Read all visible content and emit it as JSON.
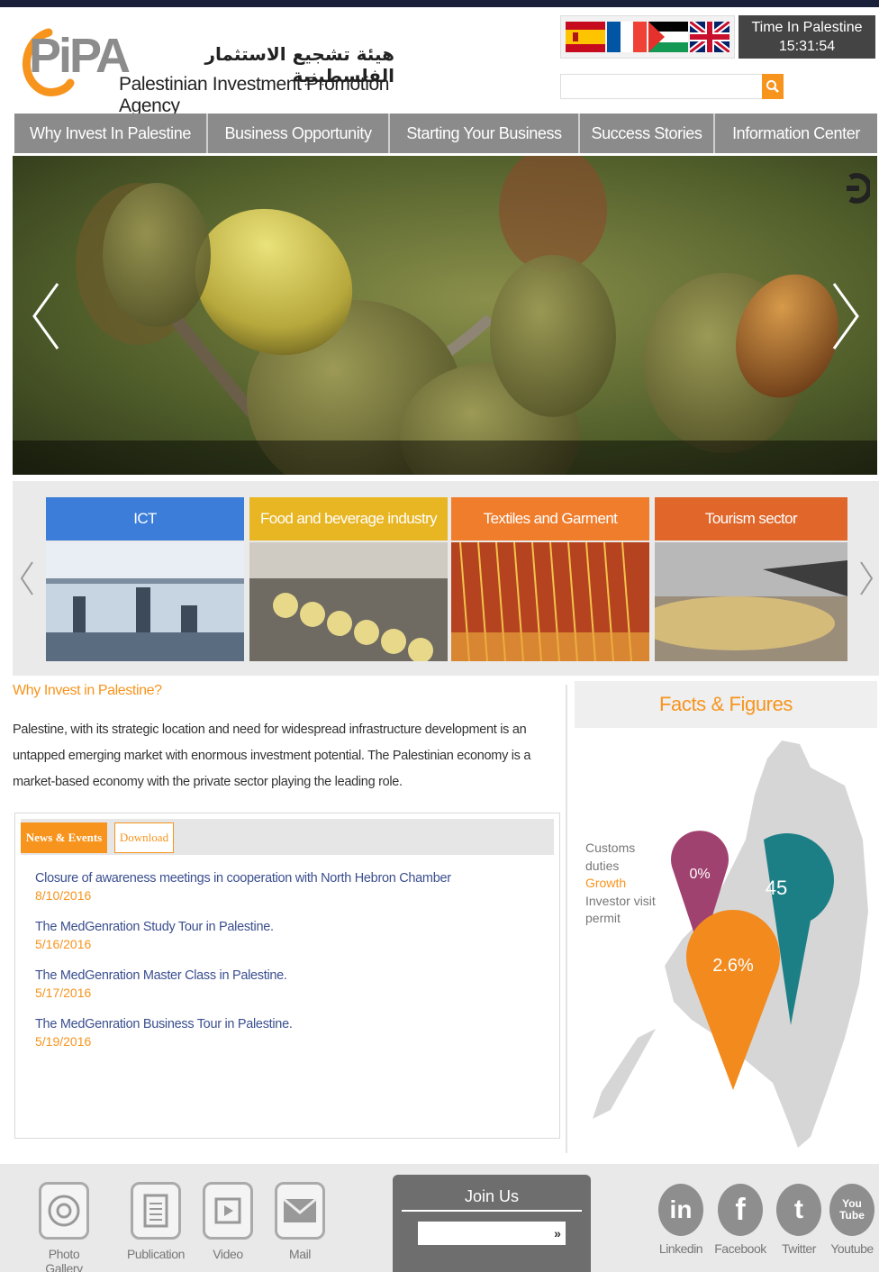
{
  "header": {
    "logo_text": "PiPA",
    "arabic_name": "هيئة تشجيع الاستثمار الفلسطينية",
    "english_name": "Palestinian Investment Promotion Agency",
    "time_label": "Time In Palestine",
    "time_value": "15:31:54",
    "search_placeholder": "",
    "flags": [
      "spanish-flag-icon",
      "french-flag-icon",
      "palestinian-flag-icon",
      "uk-flag-icon"
    ]
  },
  "nav": {
    "items": [
      "Why Invest In Palestine",
      "Business Opportunity",
      "Starting Your Business",
      "Success Stories",
      "Information Center"
    ]
  },
  "sectors": [
    {
      "label": "ICT",
      "color": "#3b7dd8"
    },
    {
      "label": "Food and beverage industry",
      "color": "#e8b523"
    },
    {
      "label": "Textiles and Garment",
      "color": "#f07d2c"
    },
    {
      "label": "Tourism sector",
      "color": "#e0662a"
    }
  ],
  "why": {
    "title": "Why Invest in Palestine?",
    "text": "Palestine, with its strategic location and need for widespread infrastructure development is an untapped emerging market with enormous investment potential. The Palestinian economy is a market-based economy with the private sector playing the leading role."
  },
  "tabs": {
    "active": "News & Events",
    "inactive": "Download"
  },
  "news": [
    {
      "title": "Closure of awareness meetings in cooperation with North Hebron Chamber",
      "date": "8/10/2016"
    },
    {
      "title": "The MedGenration Study Tour in Palestine.",
      "date": "5/16/2016"
    },
    {
      "title": "The MedGenration Master Class in Palestine.",
      "date": "5/17/2016"
    },
    {
      "title": "The MedGenration Business Tour in Palestine.",
      "date": "5/19/2016"
    }
  ],
  "facts": {
    "title": "Facts & Figures",
    "labels": {
      "customs": "Customs duties",
      "growth": "Growth",
      "investor": "Investor visit permit"
    },
    "pins": {
      "customs": "0%",
      "investor": "45",
      "growth": "2.6%"
    },
    "colors": {
      "customs": "#a0426f",
      "investor": "#1d7f86",
      "growth": "#f28a1e",
      "accent": "#f7941d"
    }
  },
  "footer": {
    "links": [
      "Photo Gallery",
      "Publication",
      "Video",
      "Mail"
    ],
    "join_title": "Join Us",
    "join_button": "»",
    "social": [
      {
        "icon": "in",
        "label": "Linkedin"
      },
      {
        "icon": "f",
        "label": "Facebook"
      },
      {
        "icon": "t",
        "label": "Twitter"
      },
      {
        "icon": "You Tube",
        "label": "Youtube"
      }
    ]
  }
}
